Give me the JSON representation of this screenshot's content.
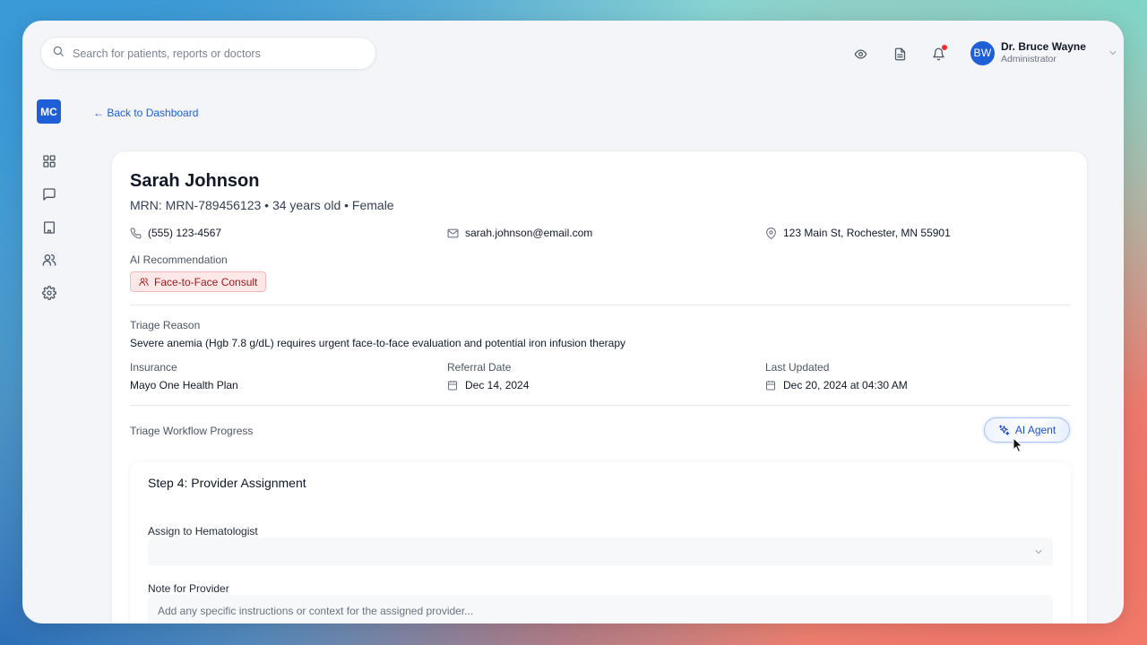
{
  "search": {
    "placeholder": "Search for patients, reports or doctors",
    "icon": "search-icon"
  },
  "header": {
    "icons": [
      "eye-icon",
      "document-icon",
      "bell-icon"
    ],
    "user": {
      "initials": "BW",
      "name": "Dr. Bruce Wayne",
      "role": "Administrator"
    }
  },
  "sidebar": {
    "logo": "MC",
    "items": [
      {
        "icon": "grid-icon"
      },
      {
        "icon": "message-icon"
      },
      {
        "icon": "building-icon"
      },
      {
        "icon": "users-icon"
      },
      {
        "icon": "settings-icon"
      }
    ]
  },
  "nav": {
    "back_label": "← Back to Dashboard"
  },
  "patient": {
    "name": "Sarah Johnson",
    "meta": "MRN: MRN-789456123 • 34 years old • Female",
    "phone": "(555) 123-4567",
    "email": "sarah.johnson@email.com",
    "address": "123 Main St, Rochester, MN 55901",
    "ai_recommendation_label": "AI Recommendation",
    "ai_recommendation": "Face-to-Face Consult",
    "triage_reason_label": "Triage Reason",
    "triage_reason": "Severe anemia (Hgb 7.8 g/dL) requires urgent face-to-face evaluation and potential iron infusion therapy",
    "insurance_label": "Insurance",
    "insurance": "Mayo One Health Plan",
    "referral_date_label": "Referral Date",
    "referral_date": "Dec 14, 2024",
    "last_updated_label": "Last Updated",
    "last_updated": "Dec 20, 2024 at 04:30 AM"
  },
  "workflow": {
    "label": "Triage Workflow Progress",
    "ai_agent_label": "AI Agent",
    "step_title": "Step 4: Provider Assignment",
    "assign_label": "Assign to Hematologist",
    "assign_value": "",
    "note_label": "Note for Provider",
    "note_placeholder": "Add any specific instructions or context for the assigned provider..."
  },
  "colors": {
    "accent": "#1e5fd8",
    "pill_bg": "#fde8e8",
    "pill_text": "#a1161c",
    "notification": "#ef2b2b"
  }
}
